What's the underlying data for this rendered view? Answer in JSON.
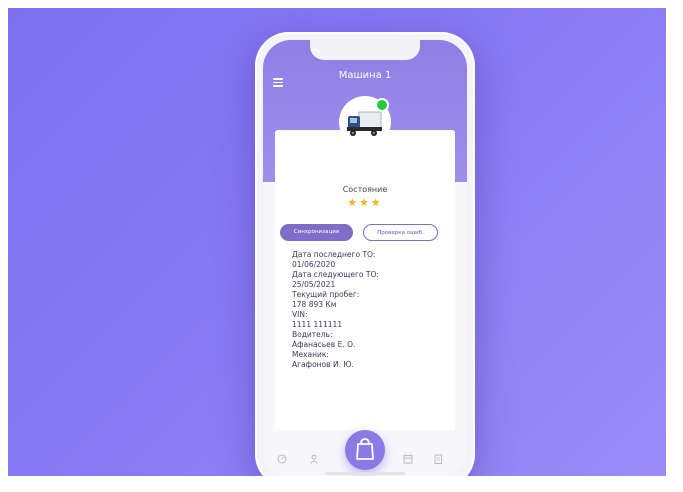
{
  "header": {
    "title": "Машина 1"
  },
  "status": {
    "label": "Состояние",
    "stars": "★★★",
    "rating_of_3": 3
  },
  "actions": {
    "sync_label": "Синхронизация",
    "check_label": "Проверка ошиб."
  },
  "info_lines": [
    "Дата последнего ТО:",
    "01/06/2020",
    "Дата следующего ТО:",
    "25/05/2021",
    "Текущий пробег:",
    "178 893 Км",
    "VIN:",
    "1111 111111",
    "Водитель:",
    "Афанасьев Е. О.",
    "Механик:",
    "Агафонов И. Ю."
  ],
  "colors": {
    "accent": "#8a7ae6",
    "button": "#7e6ec7",
    "star": "#f4b41f",
    "online": "#27c93f"
  },
  "icons": {
    "menu": "menu-icon",
    "truck": "truck-icon",
    "tab_1": "gauge-icon",
    "tab_2": "user-icon",
    "center": "bag-icon",
    "tab_4": "calendar-icon",
    "tab_5": "document-icon"
  }
}
